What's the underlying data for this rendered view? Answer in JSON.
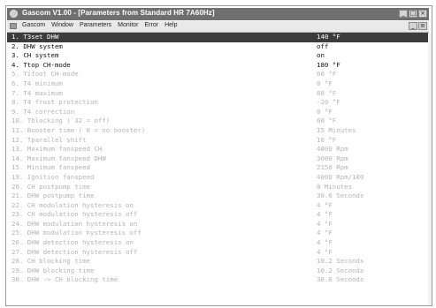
{
  "window": {
    "title": "Gascom V1.00 - [Parameters from Standard HR 7A60Hz]",
    "menu_app": "Gascom",
    "menu_items": [
      "Window",
      "Parameters",
      "Monitor",
      "Error",
      "Help"
    ],
    "title_controls": [
      "_",
      "□",
      "×"
    ],
    "menu_controls": [
      "_",
      "≡"
    ]
  },
  "parameters": [
    {
      "label": "1.  T3set DHW",
      "value": "140 °F"
    },
    {
      "label": "2.  DHW system",
      "value": "off"
    },
    {
      "label": "3.  CH system",
      "value": "on"
    },
    {
      "label": "4.  Ttop CH-mode",
      "value": "180 °F"
    },
    {
      "label": "5.  Tifoot CH-mode",
      "value": "60 °F"
    },
    {
      "label": "6.  T4 minimum",
      "value": "0 °F"
    },
    {
      "label": "7.  T4 maximum",
      "value": "60 °F"
    },
    {
      "label": "8.  T4 frost protection",
      "value": "-20 °F"
    },
    {
      "label": "9.  T4 correction",
      "value": "0 °F"
    },
    {
      "label": "10. Tblocking ( 32 = off)",
      "value": "60 °F"
    },
    {
      "label": "11. Booster time ( 0 = no booster)",
      "value": "15 Minutes"
    },
    {
      "label": "12. Tparallel shift",
      "value": "10 °F"
    },
    {
      "label": "13. Maximum fanspeed  CH",
      "value": "4800 Rpm"
    },
    {
      "label": "14. Maximum fanspeed DHW",
      "value": "3000 Rpm"
    },
    {
      "label": "15. Minimum fanspeed",
      "value": "2150 Rpm"
    },
    {
      "label": "19. Ignition fanspeed",
      "value": "4000 Rpm/100"
    },
    {
      "label": "20. CH postpump time",
      "value": "0 Minutes"
    },
    {
      "label": "21. DHW postpump time",
      "value": "30.6 Seconds"
    },
    {
      "label": "22. CH modulation hysteresis on",
      "value": "4 °F"
    },
    {
      "label": "23. CH modulation hysteresis off",
      "value": "4 °F"
    },
    {
      "label": "24. DHW modulation hysteresis on",
      "value": "4 °F"
    },
    {
      "label": "25. DHW modulation hysteresis off",
      "value": "4 °F"
    },
    {
      "label": "26. DHW detection hysteresis on",
      "value": "4 °F"
    },
    {
      "label": "27. DHW detection hysteresis off",
      "value": "4 °F"
    },
    {
      "label": "28. CH blocking time",
      "value": "10.2 Seconds"
    },
    {
      "label": "29. DHW blocking time",
      "value": "10.2 Seconds"
    },
    {
      "label": "30. DHW -> CH blocking time",
      "value": "30.6 Seconds"
    }
  ],
  "colors": {
    "titlebar": "#6f6f6f",
    "selected_row": "#3c3c3c",
    "active_text": "#111111",
    "disabled_text": "#b5b5b5"
  }
}
